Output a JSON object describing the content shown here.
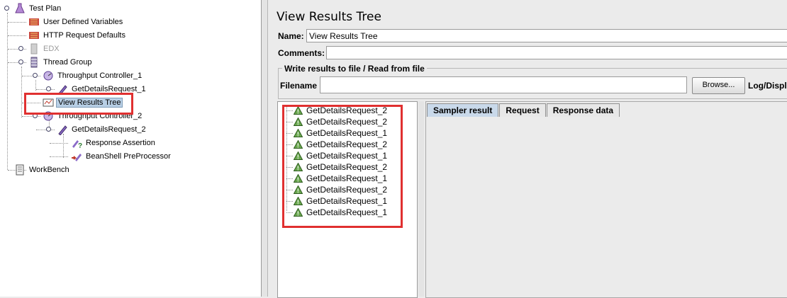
{
  "tree": {
    "items": [
      {
        "label": "Test Plan",
        "icon": "test-plan-icon"
      },
      {
        "label": "User Defined Variables",
        "icon": "config-element-icon"
      },
      {
        "label": "HTTP Request Defaults",
        "icon": "config-element-icon"
      },
      {
        "label": "EDX",
        "icon": "thread-group-icon"
      },
      {
        "label": "Thread Group",
        "icon": "thread-group-icon"
      },
      {
        "label": "Throughput Controller_1",
        "icon": "logic-controller-icon"
      },
      {
        "label": "GetDetailsRequest_1",
        "icon": "sampler-icon"
      },
      {
        "label": "View Results Tree",
        "icon": "listener-icon"
      },
      {
        "label": "Throughput Controller_2",
        "icon": "logic-controller-icon"
      },
      {
        "label": "GetDetailsRequest_2",
        "icon": "sampler-icon"
      },
      {
        "label": "Response Assertion",
        "icon": "assertion-icon"
      },
      {
        "label": "BeanShell PreProcessor",
        "icon": "preprocessor-icon"
      },
      {
        "label": "WorkBench",
        "icon": "workbench-icon"
      }
    ]
  },
  "panel": {
    "title": "View Results Tree",
    "name_label": "Name:",
    "name_value": "View Results Tree",
    "comments_label": "Comments:",
    "file_group_title": "Write results to file / Read from file",
    "filename_label": "Filename",
    "filename_value": "",
    "browse_label": "Browse...",
    "log_display_label": "Log/Displa"
  },
  "results": {
    "items": [
      "GetDetailsRequest_2",
      "GetDetailsRequest_2",
      "GetDetailsRequest_1",
      "GetDetailsRequest_2",
      "GetDetailsRequest_1",
      "GetDetailsRequest_2",
      "GetDetailsRequest_1",
      "GetDetailsRequest_2",
      "GetDetailsRequest_1",
      "GetDetailsRequest_1"
    ],
    "status_icon": "warning-icon"
  },
  "tabs": [
    {
      "label": "Sampler result",
      "active": true
    },
    {
      "label": "Request",
      "active": false
    },
    {
      "label": "Response data",
      "active": false
    }
  ],
  "colors": {
    "highlight": "#e03030",
    "selection": "#b8cfe5",
    "warning_icon": "#6aa84f"
  }
}
